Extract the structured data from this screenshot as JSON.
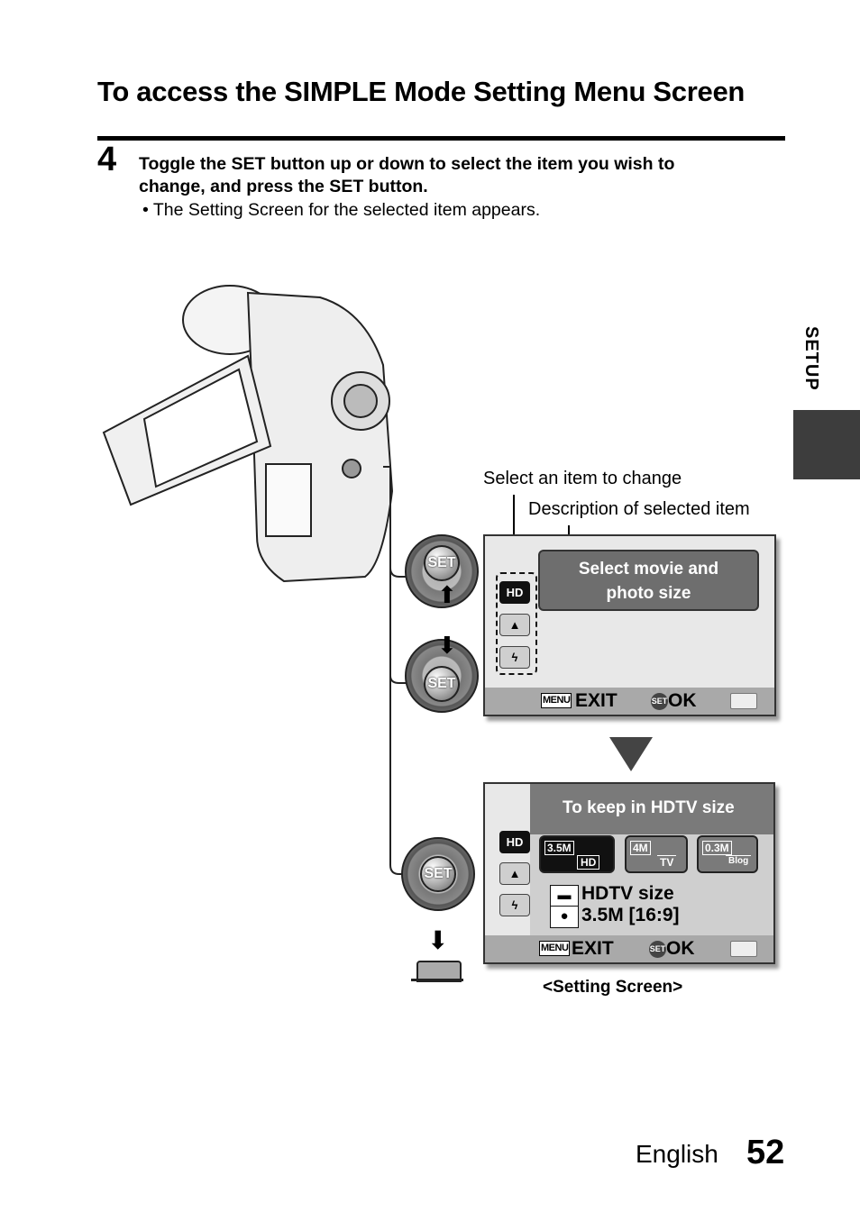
{
  "page": {
    "title": "To access the SIMPLE Mode Setting Menu Screen",
    "step_number": "4",
    "step_text_line1": "Toggle the SET button up or down to select the item you wish to",
    "step_text_line2": "change, and press the SET button.",
    "bullet": "•  The Setting Screen for the selected item appears.",
    "side_tab_label": "SETUP",
    "footer_language": "English",
    "footer_page_number": "52"
  },
  "illustration": {
    "callout_select_item": "Select an item to change",
    "callout_description": "Description of selected item",
    "dial_label": "SET",
    "caption": "<Setting Screen>"
  },
  "menu_screen": {
    "items": [
      {
        "label": "HD",
        "icon": "hd-icon",
        "selected": true
      },
      {
        "label": "",
        "icon": "scene-icon",
        "selected": false
      },
      {
        "label": "",
        "icon": "flash-icon",
        "selected": false
      }
    ],
    "description_line1": "Select movie and",
    "description_line2": "photo size",
    "menu_key": "MENU",
    "exit_label": "EXIT",
    "set_key": "SET",
    "ok_label": "OK"
  },
  "setting_screen": {
    "header": "To keep in HDTV size",
    "options": [
      {
        "photo": "3.5M",
        "video": "HD",
        "selected": true
      },
      {
        "photo": "4M",
        "video": "TV",
        "selected": false
      },
      {
        "photo": "0.3M",
        "video": "Blog",
        "selected": false
      }
    ],
    "info_video": "HDTV size",
    "info_photo": "3.5M [16:9]",
    "menu_key": "MENU",
    "exit_label": "EXIT",
    "set_key": "SET",
    "ok_label": "OK"
  },
  "colors": {
    "side_tab": "#3d3d3d",
    "screen_bg": "#e8e8e8",
    "description_box": "#6e6e6e",
    "bottom_bar": "#a9a9a9"
  }
}
